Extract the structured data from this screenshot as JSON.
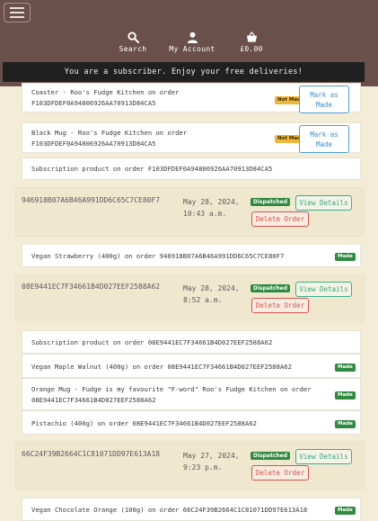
{
  "nav": {
    "search_label": "Search",
    "account_label": "My Account",
    "cart_label": "£0.00"
  },
  "banner": {
    "text": "You are a subscriber. Enjoy your free deliveries!"
  },
  "first_group_items": [
    {
      "text": "Coaster - Roo's Fudge Kitchen on order",
      "order": "F103DFDEF0A94806926AA70913D84CA5",
      "status": "Not Made",
      "button": "Mark as Made"
    },
    {
      "text": "Black Mug - Roo's Fudge Kitchen on order",
      "order": "F103DFDEF0A94806926AA70913D84CA5",
      "status": "Not Made",
      "button": "Mark as Made"
    },
    {
      "text": "Subscription product on order F103DFDEF0A94806926AA70913D84CA5"
    }
  ],
  "orders": [
    {
      "id": "946918B07A6B46A991DD6C65C7CE80F7",
      "date": "May 28, 2024, 10:43 a.m.",
      "status": "Dispatched",
      "view_label": "View Details",
      "delete_label": "Delete Order",
      "items": [
        {
          "text": "Vegan Strawberry (400g) on order 946918B07A6B46A991DD6C65C7CE80F7",
          "status": "Made"
        }
      ]
    },
    {
      "id": "08E9441EC7F34661B4D027EEF2588A62",
      "date": "May 28, 2024, 8:52 a.m.",
      "status": "Dispatched",
      "view_label": "View Details",
      "delete_label": "Delete Order",
      "items": [
        {
          "text": "Subscription product on order 08E9441EC7F34661B4D027EEF2588A62"
        },
        {
          "text": "Vegan Maple Walnut (400g) on order 08E9441EC7F34661B4D027EEF2588A62",
          "status": "Made"
        },
        {
          "text": "Orange Mug - Fudge is my favourite \"F-word\" Roo's Fudge Kitchen on order",
          "text2": "08E9441EC7F34661B4D027EEF2588A62",
          "status": "Made"
        },
        {
          "text": "Pistachio (400g) on order 08E9441EC7F34661B4D027EEF2588A62",
          "status": "Made"
        }
      ]
    },
    {
      "id": "66C24F39B2664C1C81071DD97E613A18",
      "date": "May 27, 2024, 9:23 p.m.",
      "status": "Dispatched",
      "view_label": "View Details",
      "delete_label": "Delete Order",
      "items": [
        {
          "text": "Vegan Chocolate Orange (100g) on order 66C24F39B2664C1C81071DD97E613A18",
          "status": "Made"
        }
      ]
    }
  ]
}
